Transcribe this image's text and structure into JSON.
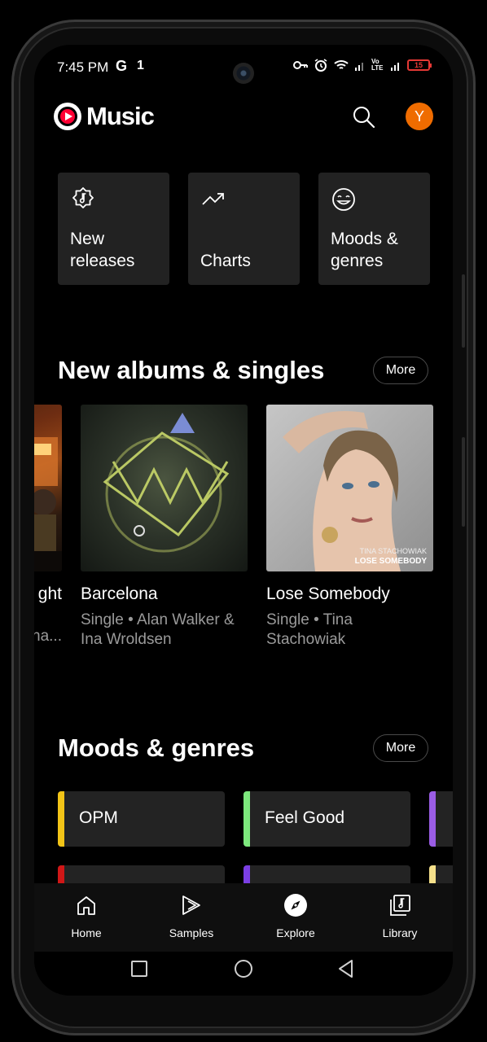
{
  "status_bar": {
    "time": "7:45 PM",
    "g_indicator": "G",
    "sim_indicator": "1",
    "volte": "Vo LTE",
    "battery": "15"
  },
  "header": {
    "app_name": "Music",
    "avatar_letter": "Y"
  },
  "tiles": [
    {
      "label": "New releases",
      "icon": "new-releases-icon"
    },
    {
      "label": "Charts",
      "icon": "trending-up-icon"
    },
    {
      "label": "Moods & genres",
      "icon": "smiley-icon"
    }
  ],
  "new_albums": {
    "title": "New albums & singles",
    "more_label": "More",
    "partial_card": {
      "title": "ght",
      "subtitle": "ha..."
    },
    "cards": [
      {
        "title": "Barcelona",
        "subtitle": "Single • Alan Walker & Ina Wroldsen"
      },
      {
        "title": "Lose Somebody",
        "subtitle": "Single • Tina Stachowiak",
        "art_text_1": "TINA STACHOWIAK",
        "art_text_2": "LOSE SOMEBODY"
      }
    ]
  },
  "moods": {
    "title": "Moods & genres",
    "more_label": "More",
    "chips": [
      {
        "label": "OPM",
        "color": "#f2c417"
      },
      {
        "label": "Feel Good",
        "color": "#7de87d"
      },
      {
        "label": "",
        "color": "#9b5de5"
      },
      {
        "label": "",
        "color": "#d01717"
      },
      {
        "label": "",
        "color": "#7b3fe4"
      },
      {
        "label": "",
        "color": "#f5e08a"
      }
    ]
  },
  "bottom_nav": [
    {
      "label": "Home",
      "icon": "home-icon"
    },
    {
      "label": "Samples",
      "icon": "samples-icon"
    },
    {
      "label": "Explore",
      "icon": "explore-compass-icon",
      "active": true
    },
    {
      "label": "Library",
      "icon": "library-icon"
    }
  ]
}
